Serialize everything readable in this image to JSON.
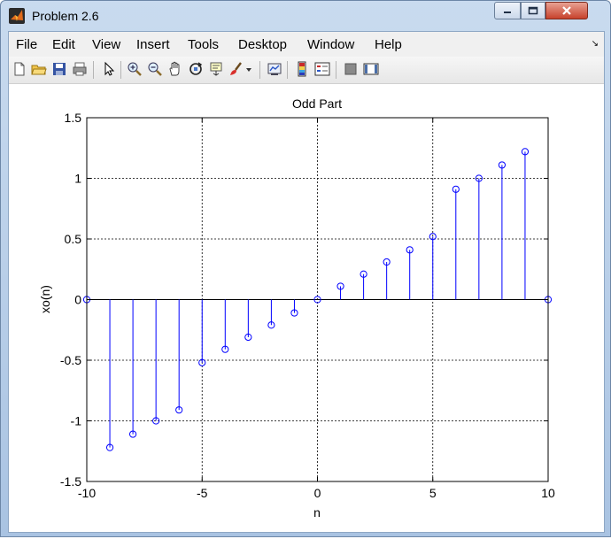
{
  "window": {
    "title": "Problem 2.6"
  },
  "menu": {
    "items": [
      "File",
      "Edit",
      "View",
      "Insert",
      "Tools",
      "Desktop",
      "Window",
      "Help"
    ],
    "arrow": "↘"
  },
  "toolbar": {
    "icons": [
      "new-figure-icon",
      "open-file-icon",
      "save-icon",
      "print-icon",
      "edit-plot-arrow-icon",
      "zoom-in-icon",
      "zoom-out-icon",
      "pan-hand-icon",
      "rotate-3d-icon",
      "data-cursor-icon",
      "brush-icon",
      "brush-dropdown-icon",
      "link-plot-icon",
      "colorbar-icon",
      "legend-icon",
      "hide-plot-tools-icon",
      "show-plot-tools-icon"
    ]
  },
  "colors": {
    "stem": "#0000ff",
    "axes": "#000000",
    "grid": "#000000",
    "background": "#ffffff"
  },
  "chart_data": {
    "type": "stem",
    "title": "Odd Part",
    "xlabel": "n",
    "ylabel": "xo(n)",
    "xlim": [
      -10,
      10
    ],
    "ylim": [
      -1.5,
      1.5
    ],
    "xticks": [
      -10,
      -5,
      0,
      5,
      10
    ],
    "yticks": [
      1.5,
      1,
      0.5,
      0,
      -0.5,
      -1,
      -1.5
    ],
    "xtick_labels": [
      "-10",
      "-5",
      "0",
      "5",
      "10"
    ],
    "ytick_labels": [
      "1.5",
      "1",
      "0.5",
      "0",
      "-0.5",
      "-1",
      "-1.5"
    ],
    "grid": true,
    "grid_style": "dashed",
    "marker": "circle",
    "x": [
      -10,
      -9,
      -8,
      -7,
      -6,
      -5,
      -4,
      -3,
      -2,
      -1,
      0,
      1,
      2,
      3,
      4,
      5,
      6,
      7,
      8,
      9,
      10
    ],
    "y": [
      0,
      -1.22,
      -1.11,
      -1.0,
      -0.91,
      -0.52,
      -0.41,
      -0.31,
      -0.21,
      -0.11,
      0,
      0.11,
      0.21,
      0.31,
      0.41,
      0.52,
      0.91,
      1.0,
      1.11,
      1.22,
      0
    ]
  }
}
